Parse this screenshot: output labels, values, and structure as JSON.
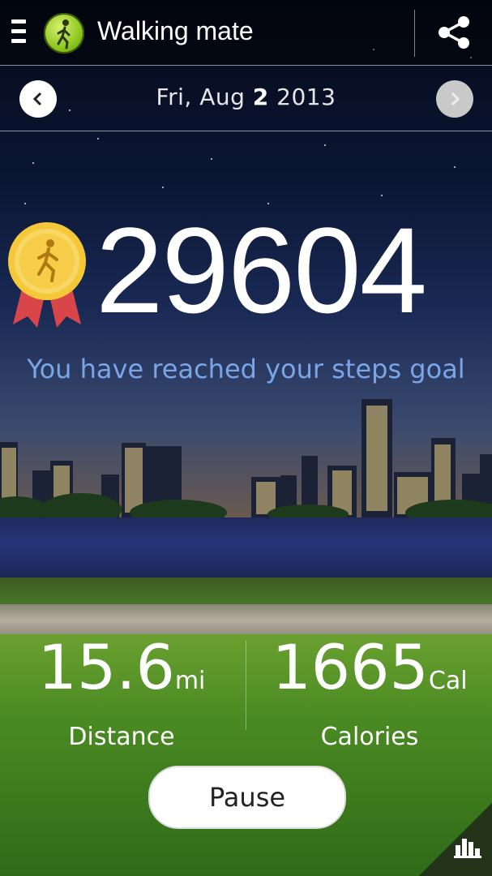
{
  "app": {
    "title": "Walking mate"
  },
  "date_nav": {
    "date_prefix": "Fri, Aug ",
    "date_day": "2",
    "date_suffix": " 2013"
  },
  "steps": {
    "count": "29604",
    "goal_message": "You have reached your steps goal"
  },
  "stats": {
    "distance": {
      "value": "15.6",
      "unit": "mi",
      "label": "Distance"
    },
    "calories": {
      "value": "1665",
      "unit": "Cal",
      "label": "Calories"
    }
  },
  "controls": {
    "pause_label": "Pause"
  },
  "icons": {
    "menu": "menu-icon",
    "app_logo": "walker-icon",
    "share": "share-icon",
    "prev": "chevron-left-icon",
    "next": "chevron-right-icon",
    "medal": "medal-icon",
    "chart": "bar-chart-icon"
  },
  "colors": {
    "goal_text": "#7aa6e8",
    "topbar_bg": "#000000",
    "grass": "#4a8a22"
  }
}
